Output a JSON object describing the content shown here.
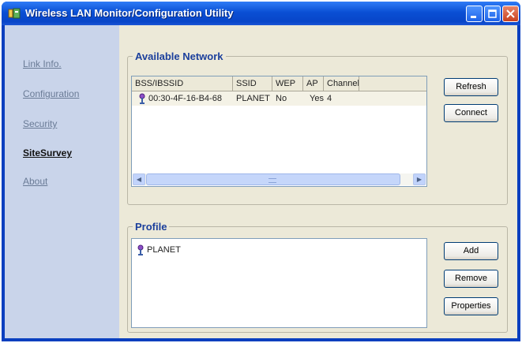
{
  "window": {
    "title": "Wireless LAN Monitor/Configuration Utility"
  },
  "sidebar": {
    "items": [
      {
        "label": "Link Info."
      },
      {
        "label": "Configuration"
      },
      {
        "label": "Security"
      },
      {
        "label": "SiteSurvey"
      },
      {
        "label": "About"
      }
    ],
    "active_item": "SiteSurvey"
  },
  "available_network": {
    "title": "Available Network",
    "columns": [
      "BSS/IBSSID",
      "SSID",
      "WEP",
      "AP",
      "Channel"
    ],
    "rows": [
      {
        "bssid": "00:30-4F-16-B4-68",
        "ssid": "PLANET",
        "wep": "No",
        "ap": "Yes",
        "channel": "4"
      }
    ],
    "buttons": {
      "refresh": "Refresh",
      "connect": "Connect"
    }
  },
  "profile": {
    "title": "Profile",
    "items": [
      {
        "name": "PLANET"
      }
    ],
    "buttons": {
      "add": "Add",
      "remove": "Remove",
      "properties": "Properties"
    }
  },
  "colors": {
    "titlebar": "#0a4fd4",
    "sidebar": "#c9d4ea",
    "dialog_bg": "#ece9d8",
    "group_title": "#1b3f9c",
    "close_button": "#c9411f"
  },
  "icons": {
    "app": "app-icon",
    "network_entry": "wireless-network-icon",
    "profile_entry": "wireless-network-icon"
  }
}
